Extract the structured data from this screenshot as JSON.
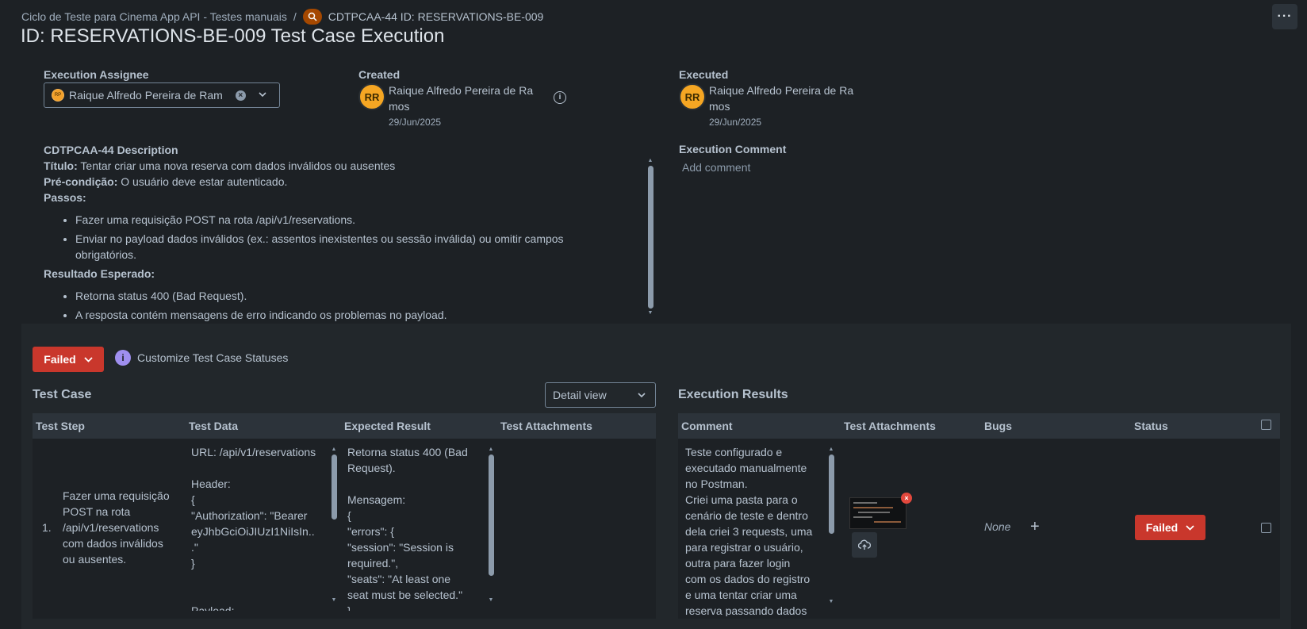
{
  "breadcrumb": {
    "project": "Ciclo de Teste para Cinema App API - Testes manuais",
    "separator": "/",
    "issue": "CDTPCAA-44 ID: RESERVATIONS-BE-009"
  },
  "more_label": "···",
  "page_title": "ID: RESERVATIONS-BE-009 Test Case Execution",
  "assignee": {
    "label": "Execution Assignee",
    "avatar_initials": "RP",
    "value": "Raique Alfredo Pereira de Ram"
  },
  "created": {
    "label": "Created",
    "initials": "RR",
    "name": "Raique Alfredo Pereira de Ra mos",
    "date": "29/Jun/2025"
  },
  "executed": {
    "label": "Executed",
    "initials": "RR",
    "name": "Raique Alfredo Pereira de Ra mos",
    "date": "29/Jun/2025"
  },
  "description": {
    "heading": "CDTPCAA-44 Description",
    "titulo_label": "Título:",
    "titulo": "Tentar criar uma nova reserva com dados inválidos ou ausentes",
    "precond_label": "Pré-condição:",
    "precond": "O usuário deve estar autenticado.",
    "passos_label": "Passos:",
    "passos": [
      "Fazer uma requisição POST na rota /api/v1/reservations.",
      "Enviar no payload dados inválidos (ex.: assentos inexistentes ou sessão inválida) ou omitir campos obrigatórios."
    ],
    "resultado_label": "Resultado Esperado:",
    "resultado": [
      "Retorna status 400 (Bad Request).",
      "A resposta contém mensagens de erro indicando os problemas no payload."
    ]
  },
  "execution_comment": {
    "label": "Execution Comment",
    "placeholder": "Add comment"
  },
  "status": {
    "value": "Failed",
    "customize": "Customize Test Case Statuses",
    "color": "#c9372c"
  },
  "test_case": {
    "title": "Test Case",
    "view": "Detail view",
    "columns": [
      "Test Step",
      "Test Data",
      "Expected Result",
      "Test Attachments"
    ],
    "row": {
      "index": "1.",
      "step": "Fazer uma requisição\nPOST na rota\n/api/v1/reservations\ncom dados inválidos\nou ausentes.",
      "data": "URL: /api/v1/reservations\n\nHeader:\n{\n\"Authorization\": \"Bearer\neyJhbGciOiJIUzI1NiIsIn..\n.\"\n}\n\n\nPayload:",
      "expected": "Retorna status 400 (Bad\nRequest).\n\nMensagem:\n{\n\"errors\": {\n\"session\": \"Session is\nrequired.\",\n\"seats\": \"At least one\nseat must be selected.\"\n}"
    }
  },
  "execution_results": {
    "title": "Execution Results",
    "columns": [
      "Comment",
      "Test Attachments",
      "Bugs",
      "Status"
    ],
    "row": {
      "comment": "Teste configurado e\nexecutado manualmente\nno Postman.\nCriei uma pasta para o\ncenário de teste e dentro\ndela criei 3 requests, uma\npara registrar o usuário,\noutra para fazer login\ncom os dados do registro\ne uma tentar criar uma\nreserva passando dados",
      "bugs": "None",
      "status": "Failed"
    }
  }
}
